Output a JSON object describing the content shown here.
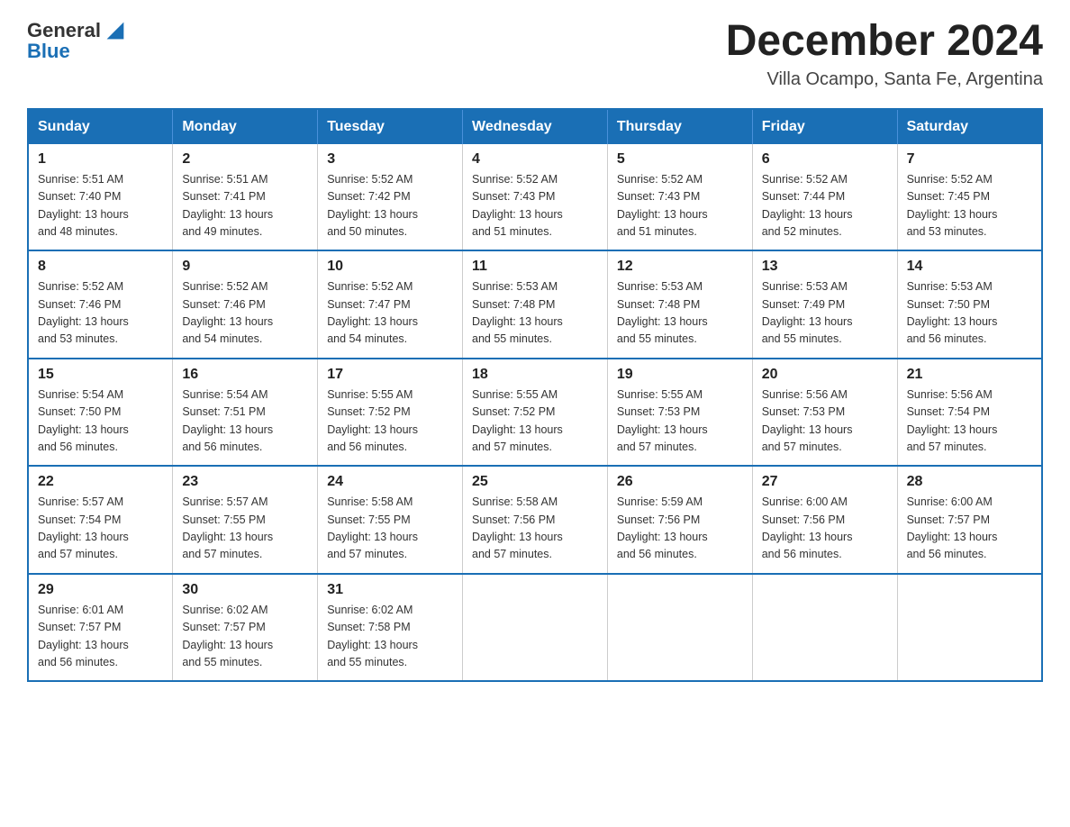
{
  "header": {
    "logo_general": "General",
    "logo_blue": "Blue",
    "month_title": "December 2024",
    "location": "Villa Ocampo, Santa Fe, Argentina"
  },
  "weekdays": [
    "Sunday",
    "Monday",
    "Tuesday",
    "Wednesday",
    "Thursday",
    "Friday",
    "Saturday"
  ],
  "weeks": [
    [
      {
        "day": "1",
        "sunrise": "5:51 AM",
        "sunset": "7:40 PM",
        "daylight": "13 hours and 48 minutes."
      },
      {
        "day": "2",
        "sunrise": "5:51 AM",
        "sunset": "7:41 PM",
        "daylight": "13 hours and 49 minutes."
      },
      {
        "day": "3",
        "sunrise": "5:52 AM",
        "sunset": "7:42 PM",
        "daylight": "13 hours and 50 minutes."
      },
      {
        "day": "4",
        "sunrise": "5:52 AM",
        "sunset": "7:43 PM",
        "daylight": "13 hours and 51 minutes."
      },
      {
        "day": "5",
        "sunrise": "5:52 AM",
        "sunset": "7:43 PM",
        "daylight": "13 hours and 51 minutes."
      },
      {
        "day": "6",
        "sunrise": "5:52 AM",
        "sunset": "7:44 PM",
        "daylight": "13 hours and 52 minutes."
      },
      {
        "day": "7",
        "sunrise": "5:52 AM",
        "sunset": "7:45 PM",
        "daylight": "13 hours and 53 minutes."
      }
    ],
    [
      {
        "day": "8",
        "sunrise": "5:52 AM",
        "sunset": "7:46 PM",
        "daylight": "13 hours and 53 minutes."
      },
      {
        "day": "9",
        "sunrise": "5:52 AM",
        "sunset": "7:46 PM",
        "daylight": "13 hours and 54 minutes."
      },
      {
        "day": "10",
        "sunrise": "5:52 AM",
        "sunset": "7:47 PM",
        "daylight": "13 hours and 54 minutes."
      },
      {
        "day": "11",
        "sunrise": "5:53 AM",
        "sunset": "7:48 PM",
        "daylight": "13 hours and 55 minutes."
      },
      {
        "day": "12",
        "sunrise": "5:53 AM",
        "sunset": "7:48 PM",
        "daylight": "13 hours and 55 minutes."
      },
      {
        "day": "13",
        "sunrise": "5:53 AM",
        "sunset": "7:49 PM",
        "daylight": "13 hours and 55 minutes."
      },
      {
        "day": "14",
        "sunrise": "5:53 AM",
        "sunset": "7:50 PM",
        "daylight": "13 hours and 56 minutes."
      }
    ],
    [
      {
        "day": "15",
        "sunrise": "5:54 AM",
        "sunset": "7:50 PM",
        "daylight": "13 hours and 56 minutes."
      },
      {
        "day": "16",
        "sunrise": "5:54 AM",
        "sunset": "7:51 PM",
        "daylight": "13 hours and 56 minutes."
      },
      {
        "day": "17",
        "sunrise": "5:55 AM",
        "sunset": "7:52 PM",
        "daylight": "13 hours and 56 minutes."
      },
      {
        "day": "18",
        "sunrise": "5:55 AM",
        "sunset": "7:52 PM",
        "daylight": "13 hours and 57 minutes."
      },
      {
        "day": "19",
        "sunrise": "5:55 AM",
        "sunset": "7:53 PM",
        "daylight": "13 hours and 57 minutes."
      },
      {
        "day": "20",
        "sunrise": "5:56 AM",
        "sunset": "7:53 PM",
        "daylight": "13 hours and 57 minutes."
      },
      {
        "day": "21",
        "sunrise": "5:56 AM",
        "sunset": "7:54 PM",
        "daylight": "13 hours and 57 minutes."
      }
    ],
    [
      {
        "day": "22",
        "sunrise": "5:57 AM",
        "sunset": "7:54 PM",
        "daylight": "13 hours and 57 minutes."
      },
      {
        "day": "23",
        "sunrise": "5:57 AM",
        "sunset": "7:55 PM",
        "daylight": "13 hours and 57 minutes."
      },
      {
        "day": "24",
        "sunrise": "5:58 AM",
        "sunset": "7:55 PM",
        "daylight": "13 hours and 57 minutes."
      },
      {
        "day": "25",
        "sunrise": "5:58 AM",
        "sunset": "7:56 PM",
        "daylight": "13 hours and 57 minutes."
      },
      {
        "day": "26",
        "sunrise": "5:59 AM",
        "sunset": "7:56 PM",
        "daylight": "13 hours and 56 minutes."
      },
      {
        "day": "27",
        "sunrise": "6:00 AM",
        "sunset": "7:56 PM",
        "daylight": "13 hours and 56 minutes."
      },
      {
        "day": "28",
        "sunrise": "6:00 AM",
        "sunset": "7:57 PM",
        "daylight": "13 hours and 56 minutes."
      }
    ],
    [
      {
        "day": "29",
        "sunrise": "6:01 AM",
        "sunset": "7:57 PM",
        "daylight": "13 hours and 56 minutes."
      },
      {
        "day": "30",
        "sunrise": "6:02 AM",
        "sunset": "7:57 PM",
        "daylight": "13 hours and 55 minutes."
      },
      {
        "day": "31",
        "sunrise": "6:02 AM",
        "sunset": "7:58 PM",
        "daylight": "13 hours and 55 minutes."
      },
      null,
      null,
      null,
      null
    ]
  ],
  "labels": {
    "sunrise_prefix": "Sunrise: ",
    "sunset_prefix": "Sunset: ",
    "daylight_prefix": "Daylight: "
  }
}
